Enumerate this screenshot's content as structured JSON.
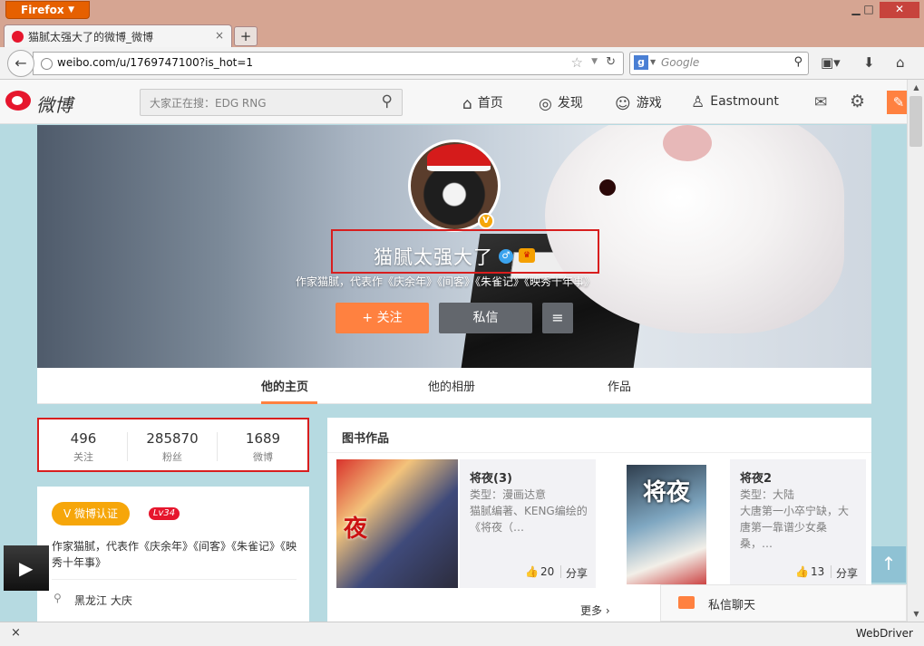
{
  "browser": {
    "app_button": "Firefox",
    "tab_title": "猫腻太强大了的微博_微博",
    "tab_close": "×",
    "new_tab": "+",
    "url": "weibo.com/u/1769747100?is_hot=1",
    "search_engine_letter": "g",
    "search_placeholder": "Google",
    "status_close": "×",
    "status_right": "WebDriver",
    "icons": [
      "back-arrow-icon",
      "globe-icon",
      "bookmark-star-icon",
      "reload-icon",
      "search-icon",
      "bookmarks-menu-icon",
      "download-icon",
      "home-icon"
    ]
  },
  "weibo_header": {
    "logo_text": "微博",
    "search_placeholder": "大家正在搜：EDG RNG",
    "nav": [
      {
        "icon": "home-icon",
        "label": "首页"
      },
      {
        "icon": "discover-icon",
        "label": "发现"
      },
      {
        "icon": "game-icon",
        "label": "游戏"
      },
      {
        "icon": "user-icon",
        "label": "Eastmount"
      }
    ],
    "accent_color": "#ff8140",
    "brand_color": "#e6162d"
  },
  "profile": {
    "nickname": "猫腻太强大了",
    "intro": "作家猫腻，代表作《庆余年》《间客》《朱雀记》《映秀十年事》",
    "follow_button": "+ 关注",
    "message_button": "私信",
    "menu_button": "≡",
    "verified_mark": "V",
    "tabs": [
      "他的主页",
      "他的相册",
      "作品"
    ],
    "active_tab": "他的主页"
  },
  "stats": [
    {
      "value": "496",
      "label": "关注"
    },
    {
      "value": "285870",
      "label": "粉丝"
    },
    {
      "value": "1689",
      "label": "微博"
    }
  ],
  "info": {
    "verify_badge": "V 微博认证",
    "level_badge": "Lv34",
    "verify_text": "作家猫腻，代表作《庆余年》《间客》《朱雀记》《映秀十年事》",
    "location": "黑龙江 大庆"
  },
  "books": {
    "title": "图书作品",
    "more": "更多 ›",
    "items": [
      {
        "cover_text": "夜",
        "name": "将夜(3)",
        "type": "类型：漫画达意",
        "desc": "猫腻编著、KENG编绘的《将夜（…",
        "likes": "20",
        "share": "分享"
      },
      {
        "cover_text": "将夜",
        "name": "将夜2",
        "type": "类型：大陆",
        "desc": "大唐第一小卒宁缺，大唐第一靠谱少女桑桑，…",
        "likes": "13",
        "share": "分享"
      }
    ]
  },
  "chat": {
    "label": "私信聊天"
  },
  "back_to_top": "↑"
}
